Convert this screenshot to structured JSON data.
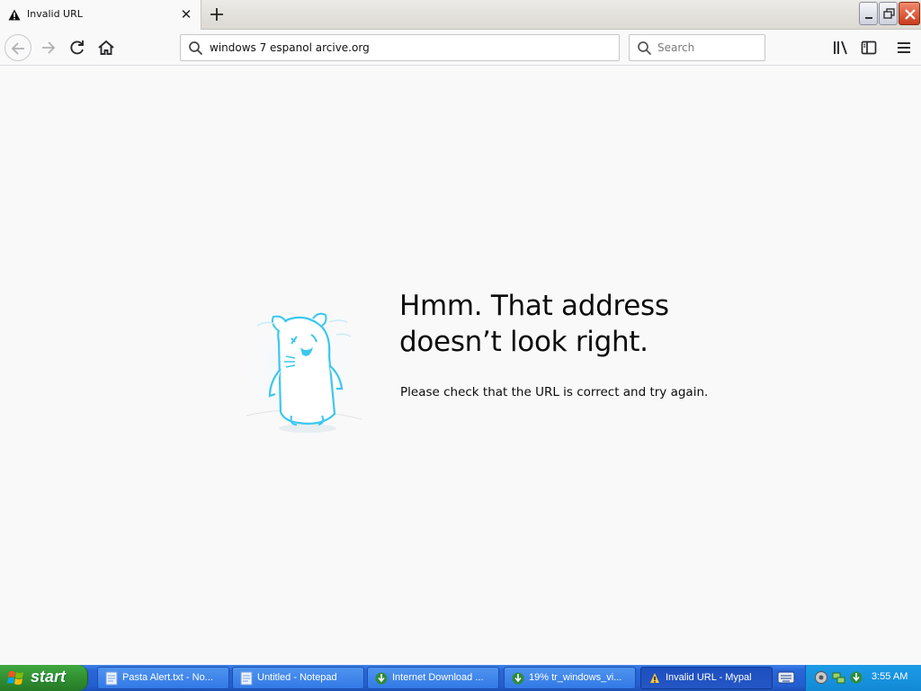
{
  "tab": {
    "title": "Invalid URL",
    "icon": "warning-icon"
  },
  "navbar": {
    "url": "windows 7 espanol arcive.org",
    "search_placeholder": "Search"
  },
  "error_page": {
    "title": "Hmm. That address doesn’t look right.",
    "description": "Please check that the URL is correct and try again."
  },
  "taskbar": {
    "start_label": "start",
    "tasks": [
      {
        "label": "Pasta Alert.txt - No...",
        "icon": "notepad-icon"
      },
      {
        "label": "Untitled - Notepad",
        "icon": "notepad-icon"
      },
      {
        "label": "Internet Download ...",
        "icon": "idm-icon"
      },
      {
        "label": "19% tr_windows_vi...",
        "icon": "idm-icon"
      },
      {
        "label": "Invalid URL - Mypal",
        "icon": "mypal-icon"
      }
    ],
    "clock": "3:55 AM"
  },
  "colors": {
    "taskbar_blue": "#245ed0",
    "start_green": "#2f8b2f",
    "page_bg": "#f9f9fa"
  }
}
